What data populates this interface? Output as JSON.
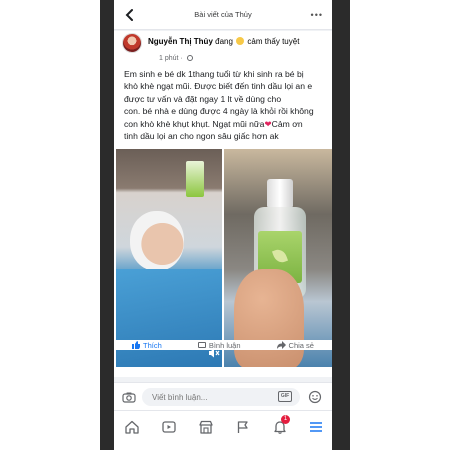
{
  "header": {
    "title": "Bài viết của Thủy"
  },
  "post": {
    "author_name": "Nguyễn Thị Thủy",
    "feeling_prefix": "đang",
    "feeling_text": "cảm thấy tuyệt",
    "feeling_suffix": "",
    "time": "1 phút ·",
    "text_lines": [
      "Em sinh e bé dk 1thang  tuổi từ khi sinh ra bé bị",
      "khò khè ngạt mũi. Được biết đến tinh dầu lọi an e",
      "được              tư vấn và đặt ngay 1 lt về dùng cho",
      "con.  bé nhà e dùng được 4 ngày là khỏi rồi không",
      "con khò khè khụt khụt. Ngạt mũi nữa",
      "tinh dầu lọi an cho ngon sâu giấc hơn ak"
    ],
    "line5_suffix": "Cảm ơn",
    "heart": "❤"
  },
  "actions": {
    "like_label": "Thích",
    "comment_label": "Bình luận",
    "share_label": "Chia sẻ"
  },
  "comment_bar": {
    "placeholder": "Viết bình luận...",
    "gif_label": "GIF"
  },
  "bottom_nav": {
    "notification_count": "1"
  },
  "colors": {
    "accent": "#1877f2",
    "badge": "#e41e3f"
  }
}
